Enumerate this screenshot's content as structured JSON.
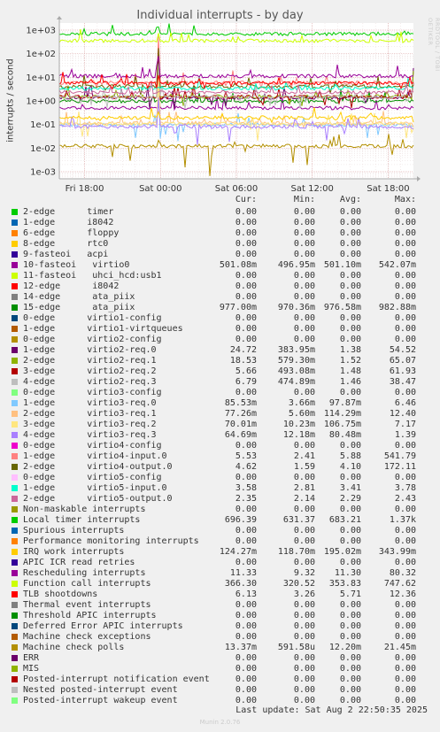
{
  "title": "Individual interrupts - by day",
  "side_text": "RRDTOOL / TOBI OETIKER",
  "footer": {
    "last_update": "Last update: Sat Aug  2 22:50:35 2025",
    "munin": "Munin 2.0.76"
  },
  "columns": {
    "cur": "Cur:",
    "min": "Min:",
    "avg": "Avg:",
    "max": "Max:"
  },
  "chart_data": {
    "type": "line",
    "title": "Individual interrupts - by day",
    "ylabel": "interrupts / second",
    "yscale": "log",
    "ylim": [
      0.0005,
      2000
    ],
    "y_ticks": [
      "1e-03",
      "1e-02",
      "1e-01",
      "1e+00",
      "1e+01",
      "1e+02",
      "1e+03"
    ],
    "x_ticks": [
      "Fri 18:00",
      "Sat 00:00",
      "Sat 06:00",
      "Sat 12:00",
      "Sat 18:00"
    ],
    "grid": true,
    "series": [
      {
        "name": "2-edge      timer",
        "color": "#00cc00",
        "cur": "0.00",
        "min": "0.00",
        "avg": "0.00",
        "max": "0.00"
      },
      {
        "name": "1-edge      i8042",
        "color": "#0066b3",
        "cur": "0.00",
        "min": "0.00",
        "avg": "0.00",
        "max": "0.00"
      },
      {
        "name": "6-edge      floppy",
        "color": "#ff8000",
        "cur": "0.00",
        "min": "0.00",
        "avg": "0.00",
        "max": "0.00"
      },
      {
        "name": "8-edge      rtc0",
        "color": "#ffcc00",
        "cur": "0.00",
        "min": "0.00",
        "avg": "0.00",
        "max": "0.00"
      },
      {
        "name": "9-fasteoi   acpi",
        "color": "#330099",
        "cur": "0.00",
        "min": "0.00",
        "avg": "0.00",
        "max": "0.00"
      },
      {
        "name": "10-fasteoi   virtio0",
        "color": "#990099",
        "cur": "501.08m",
        "min": "496.95m",
        "avg": "501.10m",
        "max": "542.07m"
      },
      {
        "name": "11-fasteoi   uhci_hcd:usb1",
        "color": "#ccff00",
        "cur": "0.00",
        "min": "0.00",
        "avg": "0.00",
        "max": "0.00"
      },
      {
        "name": "12-edge      i8042",
        "color": "#ff0000",
        "cur": "0.00",
        "min": "0.00",
        "avg": "0.00",
        "max": "0.00"
      },
      {
        "name": "14-edge      ata_piix",
        "color": "#808080",
        "cur": "0.00",
        "min": "0.00",
        "avg": "0.00",
        "max": "0.00"
      },
      {
        "name": "15-edge      ata_piix",
        "color": "#008f00",
        "cur": "977.00m",
        "min": "970.36m",
        "avg": "976.58m",
        "max": "982.88m"
      },
      {
        "name": "0-edge      virtio1-config",
        "color": "#00487d",
        "cur": "0.00",
        "min": "0.00",
        "avg": "0.00",
        "max": "0.00"
      },
      {
        "name": "1-edge      virtio1-virtqueues",
        "color": "#b35a00",
        "cur": "0.00",
        "min": "0.00",
        "avg": "0.00",
        "max": "0.00"
      },
      {
        "name": "0-edge      virtio2-config",
        "color": "#b38f00",
        "cur": "0.00",
        "min": "0.00",
        "avg": "0.00",
        "max": "0.00"
      },
      {
        "name": "1-edge      virtio2-req.0",
        "color": "#6b006b",
        "cur": "24.72",
        "min": "383.95m",
        "avg": "1.38",
        "max": "54.52"
      },
      {
        "name": "2-edge      virtio2-req.1",
        "color": "#8fb300",
        "cur": "18.53",
        "min": "579.30m",
        "avg": "1.52",
        "max": "65.07"
      },
      {
        "name": "3-edge      virtio2-req.2",
        "color": "#b30000",
        "cur": "5.66",
        "min": "493.08m",
        "avg": "1.48",
        "max": "61.93"
      },
      {
        "name": "4-edge      virtio2-req.3",
        "color": "#bebebe",
        "cur": "6.79",
        "min": "474.89m",
        "avg": "1.46",
        "max": "38.47"
      },
      {
        "name": "0-edge      virtio3-config",
        "color": "#80ff80",
        "cur": "0.00",
        "min": "0.00",
        "avg": "0.00",
        "max": "0.00"
      },
      {
        "name": "1-edge      virtio3-req.0",
        "color": "#80c9ff",
        "cur": "85.53m",
        "min": "3.66m",
        "avg": "97.87m",
        "max": "6.46"
      },
      {
        "name": "2-edge      virtio3-req.1",
        "color": "#ffc080",
        "cur": "77.26m",
        "min": "5.60m",
        "avg": "114.29m",
        "max": "12.40"
      },
      {
        "name": "3-edge      virtio3-req.2",
        "color": "#ffe680",
        "cur": "70.01m",
        "min": "10.23m",
        "avg": "106.75m",
        "max": "7.17"
      },
      {
        "name": "4-edge      virtio3-req.3",
        "color": "#aa80ff",
        "cur": "64.69m",
        "min": "12.18m",
        "avg": "80.48m",
        "max": "1.39"
      },
      {
        "name": "0-edge      virtio4-config",
        "color": "#ee00cc",
        "cur": "0.00",
        "min": "0.00",
        "avg": "0.00",
        "max": "0.00"
      },
      {
        "name": "1-edge      virtio4-input.0",
        "color": "#ff8080",
        "cur": "5.53",
        "min": "2.41",
        "avg": "5.88",
        "max": "541.79"
      },
      {
        "name": "2-edge      virtio4-output.0",
        "color": "#666600",
        "cur": "4.62",
        "min": "1.59",
        "avg": "4.10",
        "max": "172.11"
      },
      {
        "name": "0-edge      virtio5-config",
        "color": "#ffbfff",
        "cur": "0.00",
        "min": "0.00",
        "avg": "0.00",
        "max": "0.00"
      },
      {
        "name": "1-edge      virtio5-input.0",
        "color": "#00ffcc",
        "cur": "3.58",
        "min": "2.81",
        "avg": "3.41",
        "max": "3.78"
      },
      {
        "name": "2-edge      virtio5-output.0",
        "color": "#cc6699",
        "cur": "2.35",
        "min": "2.14",
        "avg": "2.29",
        "max": "2.43"
      },
      {
        "name": "Non-maskable interrupts",
        "color": "#999900",
        "cur": "0.00",
        "min": "0.00",
        "avg": "0.00",
        "max": "0.00"
      },
      {
        "name": "Local timer interrupts",
        "color": "#00cc00",
        "cur": "696.39",
        "min": "631.37",
        "avg": "683.21",
        "max": "1.37k"
      },
      {
        "name": "Spurious interrupts",
        "color": "#0066b3",
        "cur": "0.00",
        "min": "0.00",
        "avg": "0.00",
        "max": "0.00"
      },
      {
        "name": "Performance monitoring interrupts",
        "color": "#ff8000",
        "cur": "0.00",
        "min": "0.00",
        "avg": "0.00",
        "max": "0.00"
      },
      {
        "name": "IRQ work interrupts",
        "color": "#ffcc00",
        "cur": "124.27m",
        "min": "118.70m",
        "avg": "195.02m",
        "max": "343.99m"
      },
      {
        "name": "APIC ICR read retries",
        "color": "#330099",
        "cur": "0.00",
        "min": "0.00",
        "avg": "0.00",
        "max": "0.00"
      },
      {
        "name": "Rescheduling interrupts",
        "color": "#990099",
        "cur": "11.33",
        "min": "9.32",
        "avg": "11.30",
        "max": "80.32"
      },
      {
        "name": "Function call interrupts",
        "color": "#ccff00",
        "cur": "366.30",
        "min": "320.52",
        "avg": "353.83",
        "max": "747.62"
      },
      {
        "name": "TLB shootdowns",
        "color": "#ff0000",
        "cur": "6.13",
        "min": "3.26",
        "avg": "5.71",
        "max": "12.36"
      },
      {
        "name": "Thermal event interrupts",
        "color": "#808080",
        "cur": "0.00",
        "min": "0.00",
        "avg": "0.00",
        "max": "0.00"
      },
      {
        "name": "Threshold APIC interrupts",
        "color": "#008f00",
        "cur": "0.00",
        "min": "0.00",
        "avg": "0.00",
        "max": "0.00"
      },
      {
        "name": "Deferred Error APIC interrupts",
        "color": "#00487d",
        "cur": "0.00",
        "min": "0.00",
        "avg": "0.00",
        "max": "0.00"
      },
      {
        "name": "Machine check exceptions",
        "color": "#b35a00",
        "cur": "0.00",
        "min": "0.00",
        "avg": "0.00",
        "max": "0.00"
      },
      {
        "name": "Machine check polls",
        "color": "#b38f00",
        "cur": "13.37m",
        "min": "591.58u",
        "avg": "12.20m",
        "max": "21.45m"
      },
      {
        "name": "ERR",
        "color": "#6b006b",
        "cur": "0.00",
        "min": "0.00",
        "avg": "0.00",
        "max": "0.00"
      },
      {
        "name": "MIS",
        "color": "#8fb300",
        "cur": "0.00",
        "min": "0.00",
        "avg": "0.00",
        "max": "0.00"
      },
      {
        "name": "Posted-interrupt notification event",
        "color": "#b30000",
        "cur": "0.00",
        "min": "0.00",
        "avg": "0.00",
        "max": "0.00"
      },
      {
        "name": "Nested posted-interrupt event",
        "color": "#bebebe",
        "cur": "0.00",
        "min": "0.00",
        "avg": "0.00",
        "max": "0.00"
      },
      {
        "name": "Posted-interrupt wakeup event",
        "color": "#80ff80",
        "cur": "0.00",
        "min": "0.00",
        "avg": "0.00",
        "max": "0.00"
      }
    ]
  }
}
